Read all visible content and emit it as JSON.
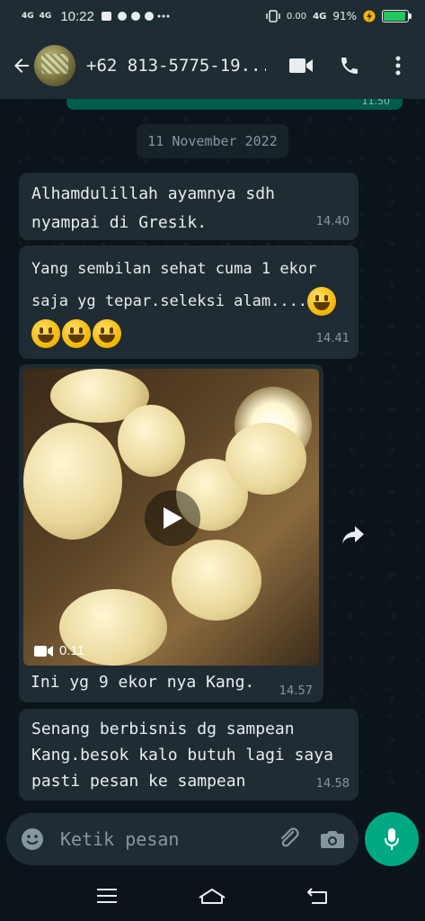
{
  "status_bar": {
    "signal1": "4G",
    "signal2": "4G",
    "time": "10:22",
    "data_rate": "0.00",
    "network": "4G",
    "battery_pct": "91%",
    "battery_level": 0.91
  },
  "header": {
    "contact_name": "+62 813-5775-19...",
    "icons": [
      "back-arrow-icon",
      "video-call-icon",
      "phone-icon",
      "more-vert-icon"
    ]
  },
  "chat": {
    "previous_message_time": "11.50",
    "date_chip": "11 November 2022",
    "messages": [
      {
        "text_line1": "Alhamdulillah ayamnya sdh",
        "text_line2": "nyampai di Gresik.",
        "time": "14.40"
      },
      {
        "text_line1": "Yang sembilan sehat cuma 1 ekor",
        "text_line2": "saja yg tepar.seleksi alam....",
        "time": "14.41",
        "emoji": "grinning-face"
      },
      {
        "type": "video",
        "duration": "0.11",
        "caption": "Ini yg 9 ekor nya Kang.",
        "time": "14.57"
      },
      {
        "text_line1": "Senang berbisnis dg sampean",
        "text_line2": "Kang.besok kalo butuh lagi saya",
        "text_line3": "pasti pesan ke sampean",
        "time": "14.58"
      }
    ]
  },
  "composer": {
    "placeholder": "Ketik pesan"
  },
  "colors": {
    "background": "#0b141a",
    "incoming_bubble": "#202c33",
    "outgoing_bubble": "#005c4b",
    "accent": "#00a884"
  }
}
